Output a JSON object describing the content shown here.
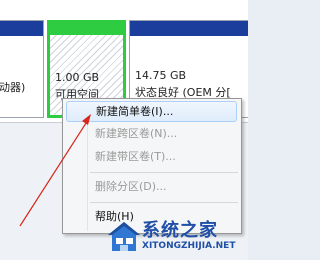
{
  "partitions": [
    {
      "line1": "动器)",
      "line2": ""
    },
    {
      "line1": "1.00 GB",
      "line2": "可用空间"
    },
    {
      "line1": "14.75 GB",
      "line2": "状态良好 (OEM 分["
    }
  ],
  "context_menu": {
    "items": [
      {
        "label": "新建简单卷(I)...",
        "enabled": true
      },
      {
        "label": "新建跨区卷(N)...",
        "enabled": false
      },
      {
        "label": "新建带区卷(T)...",
        "enabled": false
      },
      {
        "label": "删除分区(D)...",
        "enabled": false
      },
      {
        "label": "帮助(H)",
        "enabled": true
      }
    ]
  },
  "watermark": {
    "brand": "系统之家",
    "url": "XITONGZHIJIA.NET"
  },
  "colors": {
    "primary_partition": "#1b3e9c",
    "free_space": "#2ecc40",
    "arrow": "#d9261c",
    "menu_highlight": "#aecff7"
  }
}
